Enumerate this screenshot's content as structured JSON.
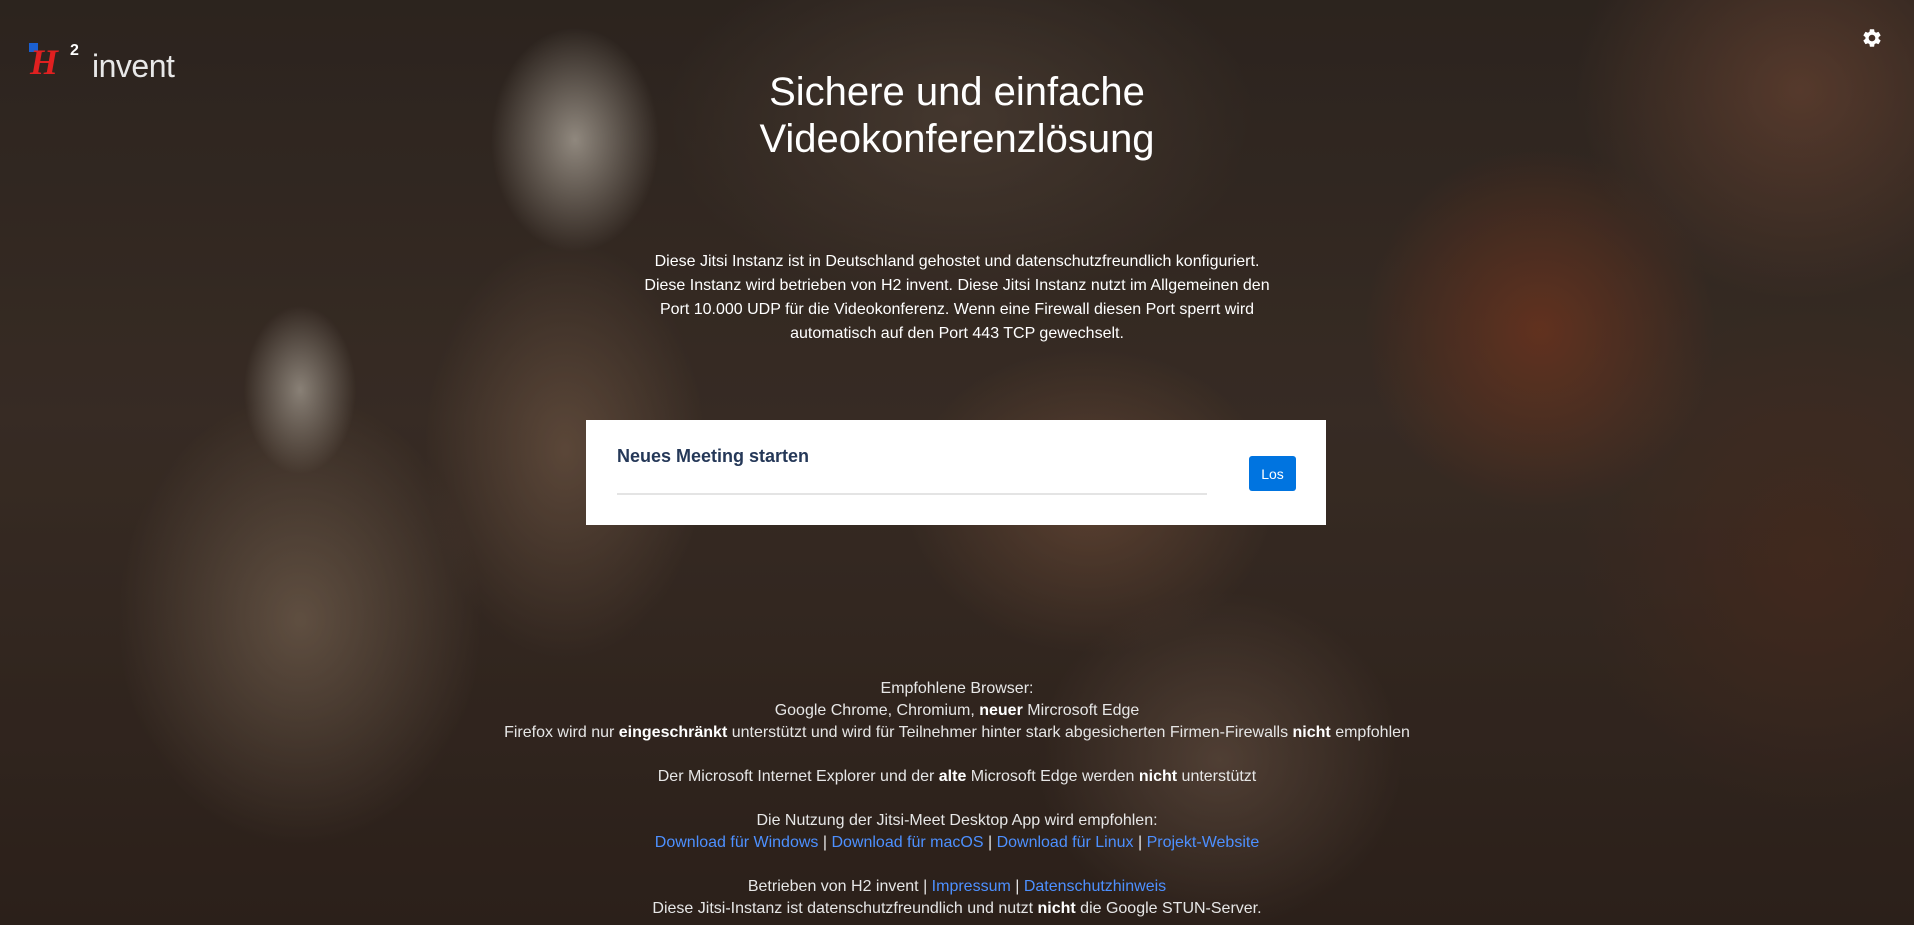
{
  "logo": {
    "sup": "2",
    "brand": "invent"
  },
  "icons": {
    "settings": "gear-icon"
  },
  "header": {
    "title_line1": "Sichere und einfache",
    "title_line2": "Videokonferenzlösung"
  },
  "description": {
    "line1": "Diese Jitsi Instanz ist in Deutschland gehostet und datenschutzfreundlich konfiguriert.",
    "line2": "Diese Instanz wird betrieben von H2 invent. Diese Jitsi Instanz nutzt im Allgemeinen den",
    "line3": "Port 10.000 UDP für die Videokonferenz. Wenn eine Firewall diesen Port sperrt wird",
    "line4": "automatisch auf den Port 443 TCP gewechselt."
  },
  "meeting": {
    "label": "Neues Meeting starten",
    "button": "Los"
  },
  "footer": {
    "browsers_heading": "Empfohlene Browser:",
    "browsers_list_a": "Google Chrome, Chromium, ",
    "browsers_list_bold": "neuer",
    "browsers_list_b": " Mircrosoft Edge",
    "firefox_a": "Firefox wird nur ",
    "firefox_bold1": "eingeschränkt",
    "firefox_b": " unterstützt und wird für Teilnehmer hinter stark abgesicherten Firmen-Firewalls ",
    "firefox_bold2": "nicht",
    "firefox_c": " empfohlen",
    "ie_a": "Der Microsoft Internet Explorer und der ",
    "ie_bold1": "alte",
    "ie_b": " Microsoft Edge werden ",
    "ie_bold2": "nicht",
    "ie_c": " unterstützt",
    "app_heading": "Die Nutzung der Jitsi-Meet Desktop App wird empfohlen:",
    "link_windows": "Download für Windows",
    "link_macos": "Download für macOS",
    "link_linux": "Download für Linux",
    "link_project": "Projekt-Website",
    "separator": " | ",
    "operated_by": "Betrieben von H2 invent | ",
    "link_impressum": "Impressum",
    "link_privacy": "Datenschutzhinweis",
    "stun_a": "Diese Jitsi-Instanz ist datenschutzfreundlich und nutzt ",
    "stun_bold": "nicht",
    "stun_b": " die Google STUN-Server."
  },
  "colors": {
    "button": "#0074e0",
    "link": "#4d90ff",
    "card_text": "#253858",
    "logo_red": "#e02020",
    "logo_blue": "#1a5fd0"
  }
}
